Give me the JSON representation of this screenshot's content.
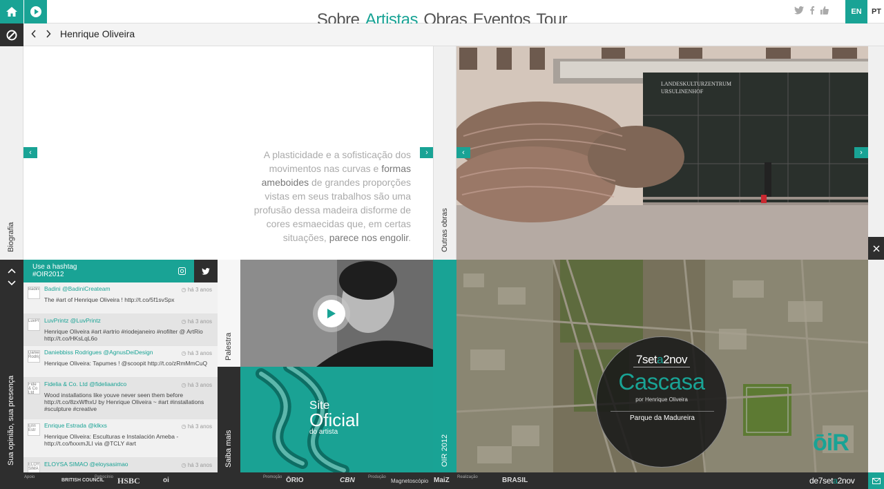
{
  "nav": {
    "items": [
      "Sobre",
      "Artistas",
      "Obras",
      "Eventos",
      "Tour"
    ],
    "active": "Artistas"
  },
  "lang": {
    "en": "EN",
    "pt": "PT"
  },
  "breadcrumb": {
    "title": "Henrique Oliveira"
  },
  "rails": {
    "biografia": "Biografia",
    "outras_obras": "Outras obras",
    "sua_opiniao": "Sua opinião, sua presença",
    "palestra": "Palestra",
    "saiba_mais": "Saiba mais",
    "oir": "OIR 2012"
  },
  "quote": {
    "p1": "A plasticidade e a sofisticação dos movimentos nas curvas e ",
    "b1": "formas ameboides",
    "p2": " de grandes proporções vistas em seus trabalhos são uma profusão dessa madeira disforme de cores esmaecidas que, em certas situações, ",
    "b2": "parece nos engolir",
    "p3": "."
  },
  "photo": {
    "sign1": "LANDESKULTURZENTRUM",
    "sign2": "URSULINENHOF"
  },
  "tweets": {
    "header": "Use a hashtag",
    "hashtag": "#OIR2012",
    "items": [
      {
        "user": "Badini @BadiniCreateam",
        "time": "há 3 anos",
        "text": "The #art of Henrique Oliveira ! http://t.co/5f1svSpx",
        "alt": "Badini"
      },
      {
        "user": "LuvPrintz @LuvPrintz",
        "time": "há 3 anos",
        "text": "Henrique Oliveira #art #artrio #riodejaneiro #nofilter @ ArtRio http://t.co/HKsLqL6o",
        "alt": "LuvPr"
      },
      {
        "user": "Daniebbiss Rodrigues @AgnusDeiDesign",
        "time": "há 3 anos",
        "text": "Henrique Oliveira: Tapumes ! @scoopit http://t.co/zRmMmCuQ",
        "alt": "Daniel Rodrigu"
      },
      {
        "user": "Fidelia & Co. Ltd @fideliaandco",
        "time": "há 3 anos",
        "text": "Wood installations like youve never seen them before http://t.co/8zxWfhxU by Henrique Oliveira ~ #art #installations #sculpture #creative",
        "alt": "Fide & Co Ltd"
      },
      {
        "user": "Enrique Estrada @klkxs",
        "time": "há 3 anos",
        "text": "Henrique Oliveira: Esculturas e Instalación Ameba - http://t.co/fxxxmJLI via @TCLY #art",
        "alt": "Enri Estr"
      },
      {
        "user": "ELOYSA SIMAO @eloysasimao",
        "time": "há 3 anos",
        "text": "",
        "alt": "ELOY SIMA"
      }
    ]
  },
  "site": {
    "l1": "Site",
    "l2": "Oficial",
    "l3": "do artista"
  },
  "badge": {
    "date_a": "7set",
    "date_b": "a",
    "date_c": "2nov",
    "title": "Cascasa",
    "by": "por Henrique Oliveira",
    "place": "Parque da Madureira"
  },
  "map": {
    "logo": "ōiR"
  },
  "footer": {
    "apoio": "Apoio",
    "patrocinio": "Patrocínio",
    "promocao": "Promoção",
    "producao": "Produção",
    "realizacao": "Realização",
    "logos": [
      "BRITISH COUNCIL",
      "HSBC",
      "oi",
      "ŌRIO",
      "CBN",
      "Magnetoscópio",
      "MaiZ",
      "BRASIL"
    ],
    "brand_a": "de7set",
    "brand_b": "a",
    "brand_c": "2nov"
  },
  "colors": {
    "accent": "#19a395",
    "dark": "#2e2e2e"
  }
}
